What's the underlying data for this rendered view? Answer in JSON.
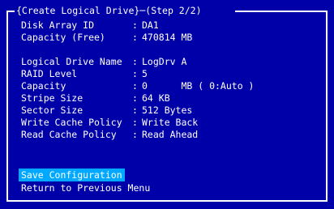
{
  "header": {
    "title": "{Create Logical Drive}",
    "step": "(Step 2/2)"
  },
  "info": [
    {
      "label": "Disk Array ID",
      "value": "DA1"
    },
    {
      "label": "Capacity (Free)",
      "value": "470814 MB"
    }
  ],
  "settings": [
    {
      "label": "Logical Drive Name",
      "value": "LogDrv A"
    },
    {
      "label": "RAID Level",
      "value": "5"
    },
    {
      "label": "Capacity",
      "value": "0      MB ( 0:Auto )"
    },
    {
      "label": "Stripe Size",
      "value": "64 KB"
    },
    {
      "label": "Sector Size",
      "value": "512 Bytes"
    },
    {
      "label": "Write Cache Policy",
      "value": "Write Back"
    },
    {
      "label": "Read Cache Policy",
      "value": "Read Ahead"
    }
  ],
  "separator": ":",
  "menu": {
    "items": [
      {
        "label": "Save Configuration",
        "selected": true
      },
      {
        "label": "Return to Previous Menu",
        "selected": false
      }
    ]
  },
  "colors": {
    "background": "#0000a8",
    "text": "#ffffff",
    "highlight": "#00a8ff"
  }
}
